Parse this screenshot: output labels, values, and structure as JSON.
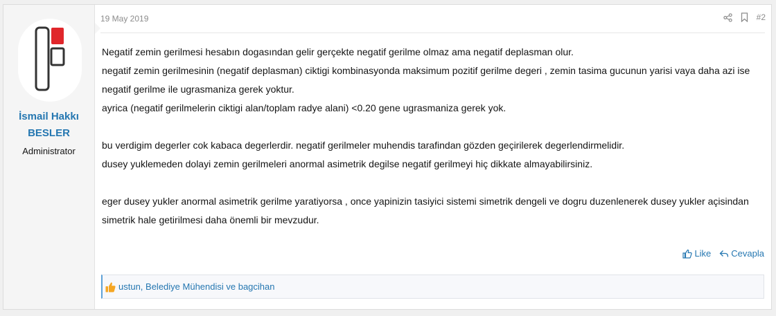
{
  "user": {
    "name_line1": "İsmail Hakkı",
    "name_line2": "BESLER",
    "title": "Administrator",
    "avatar_icon": "logo-avatar-icon",
    "avatar_accent": "#e0262b"
  },
  "post": {
    "date": "19 May 2019",
    "number": "#2",
    "share_icon": "share-icon",
    "bookmark_icon": "bookmark-icon",
    "paragraphs": [
      [
        "Negatif zemin gerilmesi hesabın dogasından gelir gerçekte negatif gerilme olmaz ama negatif deplasman olur.",
        "negatif zemin gerilmesinin (negatif deplasman) ciktigi kombinasyonda maksimum pozitif gerilme degeri , zemin tasima gucunun yarisi vaya daha azi ise",
        "negatif gerilme ile ugrasmaniza gerek yoktur.",
        "ayrica (negatif gerilmelerin ciktigi alan/toplam radye alani) <0.20 gene ugrasmaniza gerek yok."
      ],
      [
        "bu verdigim degerler cok kabaca degerlerdir. negatif gerilmeler muhendis tarafindan gözden geçirilerek degerlendirmelidir.",
        "dusey yuklemeden dolayi zemin gerilmeleri anormal asimetrik degilse negatif gerilmeyi hiç dikkate almayabilirsiniz."
      ],
      [
        "eger dusey yukler anormal asimetrik gerilme yaratiyorsa , once yapinizin tasiyici sistemi simetrik dengeli ve dogru duzenlenerek dusey yukler açisindan",
        "simetrik hale getirilmesi daha önemli bir mevzudur."
      ]
    ]
  },
  "actions": {
    "like_label": "Like",
    "reply_label": "Cevapla",
    "like_icon": "thumbs-up-icon",
    "reply_icon": "reply-icon"
  },
  "reactions": {
    "text": "ustun, Belediye Mühendisi ve bagcihan",
    "icon": "thumbs-up-reaction-icon"
  },
  "colors": {
    "link": "#2577b1",
    "muted": "#8c8c8c",
    "user_col_bg": "#f5f5f5",
    "reaction_accent": "#f5a623"
  }
}
